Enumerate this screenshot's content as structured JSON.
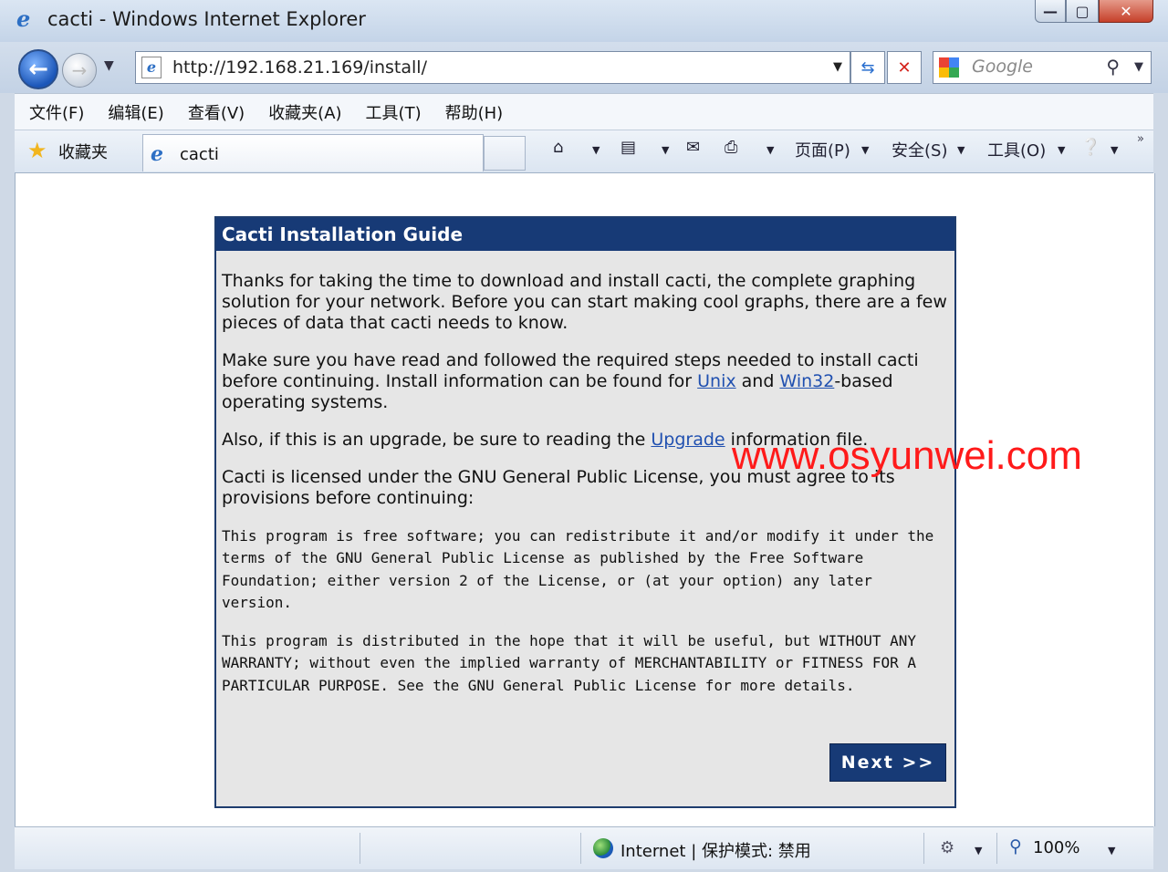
{
  "window": {
    "title": "cacti - Windows Internet Explorer",
    "minimize": "—",
    "maximize": "▢",
    "close": "✕"
  },
  "nav": {
    "address": "http://192.168.21.169/install/",
    "search_placeholder": "Google"
  },
  "menu": {
    "items": [
      "文件(F)",
      "编辑(E)",
      "查看(V)",
      "收藏夹(A)",
      "工具(T)",
      "帮助(H)"
    ]
  },
  "favorites": {
    "label": "收藏夹",
    "tab_title": "cacti"
  },
  "commandbar": {
    "page": "页面(P)",
    "safety": "安全(S)",
    "tools": "工具(O)"
  },
  "guide": {
    "title": "Cacti Installation Guide",
    "para1": "Thanks for taking the time to download and install cacti, the complete graphing solution for your network. Before you can start making cool graphs, there are a few pieces of data that cacti needs to know.",
    "para2_pre": "Make sure you have read and followed the required steps needed to install cacti before continuing. Install information can be found for ",
    "link_unix": "Unix",
    "para2_mid": " and ",
    "link_win32": "Win32",
    "para2_post": "-based operating systems.",
    "para3_pre": "Also, if this is an upgrade, be sure to reading the ",
    "link_upgrade": "Upgrade",
    "para3_post": " information file.",
    "para4": "Cacti is licensed under the GNU General Public License, you must agree to its provisions before continuing:",
    "license1": "This program is free software; you can redistribute it and/or modify it under the terms of the GNU General Public License as published by the Free Software Foundation; either version 2 of the License, or (at your option) any later version.",
    "license2": "This program is distributed in the hope that it will be useful, but WITHOUT ANY WARRANTY; without even the implied warranty of MERCHANTABILITY or FITNESS FOR A PARTICULAR PURPOSE. See the GNU General Public License for more details.",
    "next_label": "Next >>"
  },
  "watermark": "www.osyunwei.com",
  "status": {
    "zone": "Internet | 保护模式: 禁用",
    "zoom": "100%"
  },
  "colors": {
    "header_bg": "#173a76",
    "panel_bg": "#e6e6e6",
    "link": "#2050b0",
    "watermark": "#ff1a1a"
  }
}
